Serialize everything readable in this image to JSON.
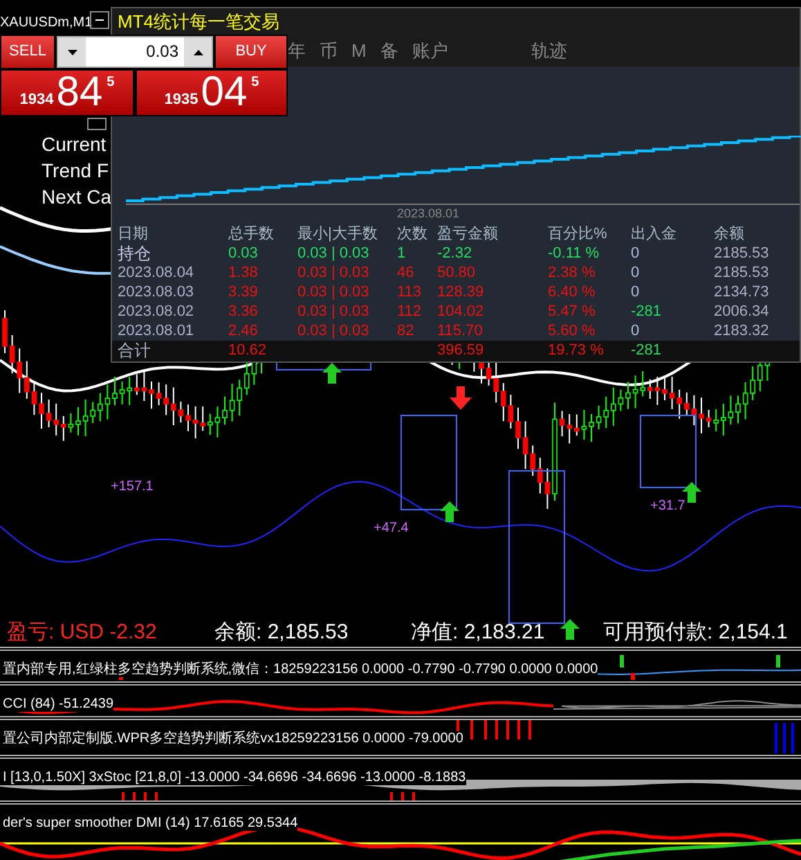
{
  "chart": {
    "symbol": "XAUUSDm,M1",
    "overlay_lines": [
      "Current",
      "Trend F",
      "Next Ca"
    ],
    "profit_labels": [
      "+157.1",
      "+47.4",
      "+31.7"
    ],
    "status": [
      {
        "text": "盈亏: USD -2.32",
        "kind": "loss"
      },
      {
        "text": "余额: 2,185.53",
        "kind": "plain"
      },
      {
        "text": "净值: 2,183.21",
        "kind": "plain"
      },
      {
        "text": "可用预付款: 2,154.1",
        "kind": "plain"
      }
    ]
  },
  "trade_panel": {
    "sell": "SELL",
    "buy": "BUY",
    "lot": "0.03",
    "bid": {
      "head": "1934",
      "big": "84",
      "sup": "5"
    },
    "ask": {
      "head": "1935",
      "big": "04",
      "sup": "5"
    }
  },
  "stats_window": {
    "title": "MT4统计每一笔交易",
    "tabs": [
      "年",
      "币",
      "M",
      "备",
      "账户",
      "轨迹"
    ],
    "axis_label": "2023.08.01",
    "columns": [
      "日期",
      "总手数",
      "最小|大手数",
      "次数",
      "盈亏金额",
      "百分比%",
      "出入金",
      "余额"
    ],
    "rows": [
      {
        "kind": "open",
        "date": "持仓",
        "lots": "0.03",
        "minmax": "0.03 | 0.03",
        "count": "1",
        "profit": "-2.32",
        "percent": "-0.11 %",
        "deposit": "0",
        "deposit_flagged": false,
        "balance": "2185.53"
      },
      {
        "kind": "closed",
        "date": "2023.08.04",
        "lots": "1.38",
        "minmax": "0.03 | 0.03",
        "count": "46",
        "profit": "50.80",
        "percent": "2.38 %",
        "deposit": "0",
        "deposit_flagged": false,
        "balance": "2185.53"
      },
      {
        "kind": "closed",
        "date": "2023.08.03",
        "lots": "3.39",
        "minmax": "0.03 | 0.03",
        "count": "113",
        "profit": "128.39",
        "percent": "6.40 %",
        "deposit": "0",
        "deposit_flagged": false,
        "balance": "2134.73"
      },
      {
        "kind": "closed",
        "date": "2023.08.02",
        "lots": "3.36",
        "minmax": "0.03 | 0.03",
        "count": "112",
        "profit": "104.02",
        "percent": "5.47 %",
        "deposit": "-281",
        "deposit_flagged": true,
        "balance": "2006.34"
      },
      {
        "kind": "closed",
        "date": "2023.08.01",
        "lots": "2.46",
        "minmax": "0.03 | 0.03",
        "count": "82",
        "profit": "115.70",
        "percent": "5.60 %",
        "deposit": "0",
        "deposit_flagged": false,
        "balance": "2183.32"
      }
    ],
    "total": {
      "label": "合计",
      "lots": "10.62",
      "profit": "396.59",
      "percent": "19.73 %",
      "deposit": "-281"
    }
  },
  "indicators": [
    {
      "kind": "bars",
      "label": "置内部专用,红绿柱多空趋势判断系统,微信：18259223156 0.0000 -0.7790 -0.7790 0.0000 0.0000"
    },
    {
      "kind": "cci",
      "label": "CCI (84) -51.2439"
    },
    {
      "kind": "histogram",
      "label": "置公司内部定制版.WPR多空趋势判断系统vx18259223156 0.0000 -79.0000"
    },
    {
      "kind": "stoch",
      "label": "I [13,0,1.50X] 3xStoc [21,8,0] -13.0000 -34.6696 -34.6696 -13.0000 -8.1883"
    },
    {
      "kind": "dmi",
      "label": "der's super smoother DMI (14) 17.6165 29.5344"
    }
  ]
}
